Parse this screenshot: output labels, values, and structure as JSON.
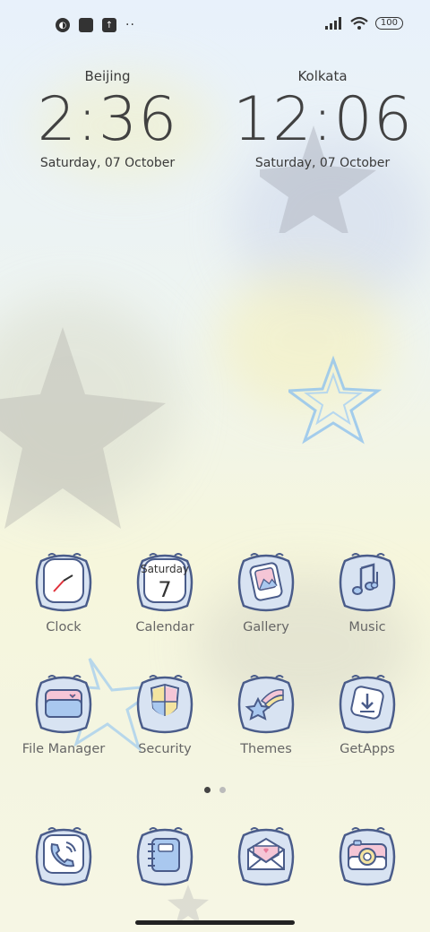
{
  "status_bar": {
    "left_icons": [
      "vpn-icon",
      "square-icon",
      "upload-icon"
    ],
    "more": "··",
    "battery": "100"
  },
  "clocks": [
    {
      "city": "Beijing",
      "time": "2:36",
      "date": "Saturday, 07 October"
    },
    {
      "city": "Kolkata",
      "time": "12:06",
      "date": "Saturday, 07 October"
    }
  ],
  "apps": [
    {
      "label": "Clock",
      "icon": "clock-icon"
    },
    {
      "label": "Calendar",
      "icon": "calendar-icon",
      "day_name": "Saturday",
      "day_num": "7"
    },
    {
      "label": "Gallery",
      "icon": "gallery-icon"
    },
    {
      "label": "Music",
      "icon": "music-icon"
    },
    {
      "label": "File Manager",
      "icon": "folder-icon"
    },
    {
      "label": "Security",
      "icon": "shield-icon"
    },
    {
      "label": "Themes",
      "icon": "star-icon"
    },
    {
      "label": "GetApps",
      "icon": "download-icon"
    }
  ],
  "dock": [
    {
      "icon": "phone-icon"
    },
    {
      "icon": "notebook-icon"
    },
    {
      "icon": "envelope-icon"
    },
    {
      "icon": "camera-icon"
    }
  ],
  "pages": {
    "count": 2,
    "active": 1
  }
}
